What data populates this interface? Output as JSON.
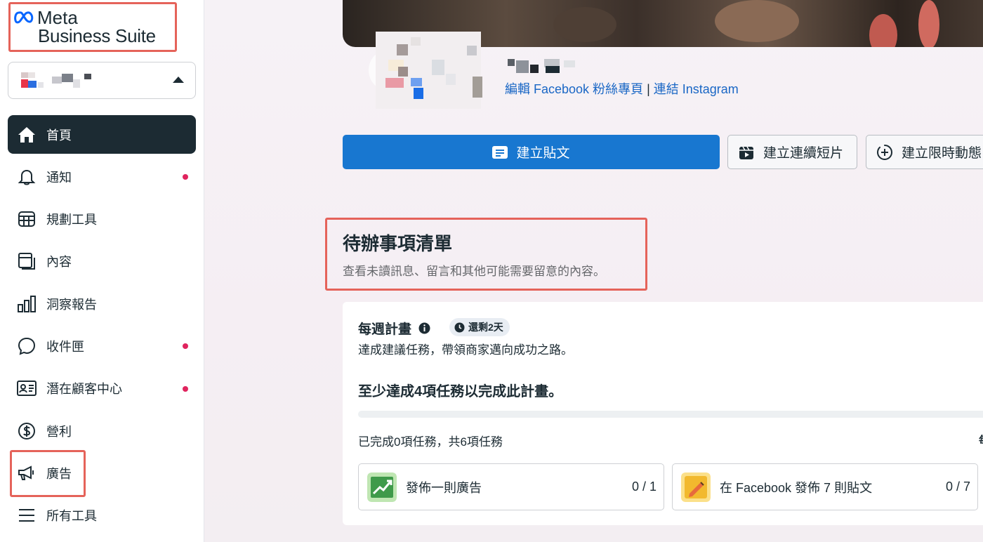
{
  "brand": {
    "line1": "Meta",
    "line2": "Business Suite"
  },
  "nav": [
    {
      "label": "首頁",
      "icon": "home-icon",
      "active": true,
      "dot": false
    },
    {
      "label": "通知",
      "icon": "bell-icon",
      "dot": true
    },
    {
      "label": "規劃工具",
      "icon": "calendar-grid-icon",
      "dot": false
    },
    {
      "label": "內容",
      "icon": "content-pages-icon",
      "dot": false
    },
    {
      "label": "洞察報告",
      "icon": "bar-chart-icon",
      "dot": false
    },
    {
      "label": "收件匣",
      "icon": "chat-bubble-icon",
      "dot": true
    },
    {
      "label": "潛在顧客中心",
      "icon": "contact-card-icon",
      "dot": true
    },
    {
      "label": "營利",
      "icon": "dollar-icon",
      "dot": false
    },
    {
      "label": "廣告",
      "icon": "megaphone-icon",
      "dot": false
    },
    {
      "label": "所有工具",
      "icon": "menu-icon",
      "dot": false
    }
  ],
  "page": {
    "edit_link": "編輯 Facebook 粉絲專頁",
    "separator": "|",
    "connect_link": "連結 Instagram"
  },
  "actions": {
    "create_post": "建立貼文",
    "create_reel": "建立連續短片",
    "create_story": "建立限時動態"
  },
  "todo": {
    "title": "待辦事項清單",
    "subtitle": "查看未讀訊息、留言和其他可能需要留意的內容。"
  },
  "plan": {
    "title": "每週計畫",
    "badge": "還剩2天",
    "description": "達成建議任務，帶領商家邁向成功之路。",
    "goal": "至少達成4項任務以完成此計畫。",
    "progress_fraction": 0,
    "completed_text": "已完成0項任務，共6項任務",
    "weekly_tag": "每週",
    "tasks": [
      {
        "label": "發佈一則廣告",
        "count": "0 / 1",
        "icon": "trend-chart-icon",
        "color": "#7ccf6a"
      },
      {
        "label": "在 Facebook 發佈 7 則貼文",
        "count": "0 / 7",
        "icon": "pencil-note-icon",
        "color": "#f4c542"
      }
    ]
  },
  "colors": {
    "primary": "#1877d0",
    "nav_active": "#1c2b33",
    "highlight": "#e5635a",
    "dot": "#e0245e"
  }
}
